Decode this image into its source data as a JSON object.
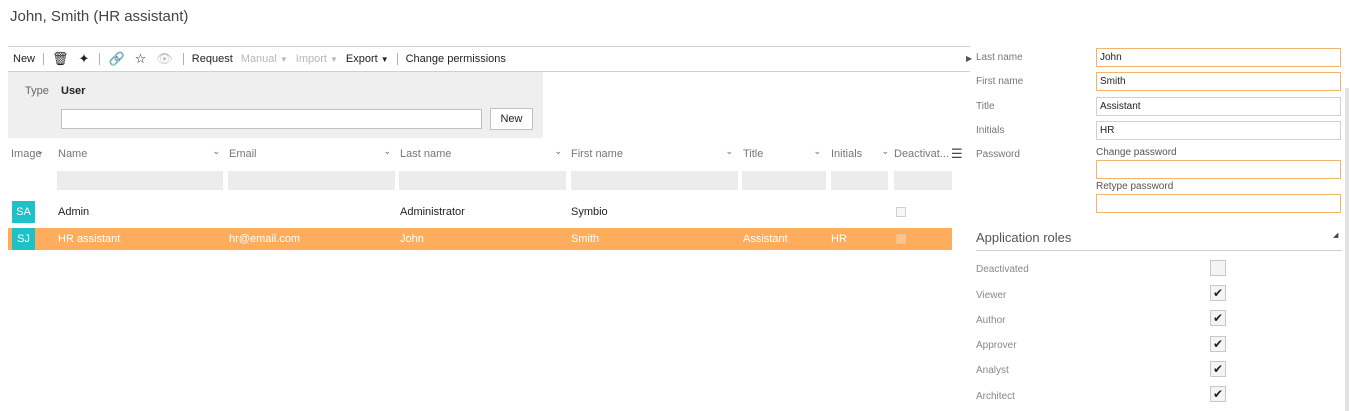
{
  "page_title": "John, Smith (HR assistant)",
  "toolbar": {
    "new_label": "New",
    "request_label": "Request",
    "manual_label": "Manual",
    "import_label": "Import",
    "export_label": "Export",
    "change_permissions_label": "Change permissions"
  },
  "filter": {
    "type_label": "Type",
    "type_value": "User",
    "search_value": "",
    "new_button": "New"
  },
  "table": {
    "columns": [
      "Image",
      "Name",
      "Email",
      "Last name",
      "First name",
      "Title",
      "Initials",
      "Deactivat..."
    ],
    "rows": [
      {
        "avatar": "SA",
        "name": "Admin",
        "email": "",
        "last_name": "Administrator",
        "first_name": "Symbio",
        "title": "",
        "initials": "",
        "deactivated": false,
        "selected": false
      },
      {
        "avatar": "SJ",
        "name": "HR assistant",
        "email": "hr@email.com",
        "last_name": "John",
        "first_name": "Smith",
        "title": "Assistant",
        "initials": "HR",
        "deactivated": false,
        "selected": true
      }
    ]
  },
  "details": {
    "last_name_label": "Last name",
    "last_name_value": "John",
    "first_name_label": "First name",
    "first_name_value": "Smith",
    "title_label": "Title",
    "title_value": "Assistant",
    "initials_label": "Initials",
    "initials_value": "HR",
    "password_label": "Password",
    "change_password_label": "Change password",
    "retype_password_label": "Retype password"
  },
  "roles": {
    "section_title": "Application roles",
    "items": [
      {
        "label": "Deactivated",
        "checked": false
      },
      {
        "label": "Viewer",
        "checked": true
      },
      {
        "label": "Author",
        "checked": true
      },
      {
        "label": "Approver",
        "checked": true
      },
      {
        "label": "Analyst",
        "checked": true
      },
      {
        "label": "Architect",
        "checked": true
      }
    ]
  },
  "colors": {
    "accent": "#ffad5c",
    "avatar": "#1cc2c8",
    "required_border": "#f0b56a"
  }
}
